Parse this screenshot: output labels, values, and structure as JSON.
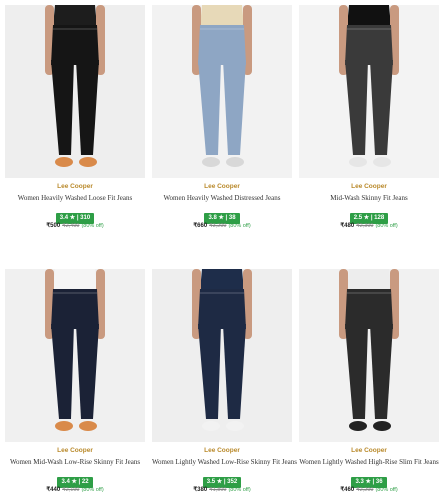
{
  "products": [
    {
      "brand": "Lee Cooper",
      "title": "Women Heavily Washed Loose Fit Jeans",
      "rating": "3.4 ★ | 310",
      "price": "₹500",
      "mrp": "₹2,499",
      "discount": "(80% off)",
      "jeans_color": "#151515",
      "bg_color": "#eeeeee",
      "top_color": "#1d1d1d",
      "shoe_color": "#d98a4a"
    },
    {
      "brand": "Lee Cooper",
      "title": "Women Heavily Washed Distressed Jeans",
      "rating": "3.8 ★ | 38",
      "price": "₹660",
      "mrp": "₹3,299",
      "discount": "(80% off)",
      "jeans_color": "#8ea6c4",
      "bg_color": "#f2f2f2",
      "top_color": "#e7d9b8",
      "shoe_color": "#d8d8d8"
    },
    {
      "brand": "Lee Cooper",
      "title": "Mid-Wash Skinny Fit Jeans",
      "rating": "2.5 ★ | 128",
      "price": "₹480",
      "mrp": "₹2,399",
      "discount": "(80% off)",
      "jeans_color": "#3a3a3a",
      "bg_color": "#f3f3f3",
      "top_color": "#111111",
      "shoe_color": "#e6e6e6"
    },
    {
      "brand": "Lee Cooper",
      "title": "Women Mid-Wash Low-Rise Skinny Fit Jeans",
      "rating": "3.4 ★ | 22",
      "price": "₹440",
      "mrp": "₹2,199",
      "discount": "(80% off)",
      "jeans_color": "#1b2236",
      "bg_color": "#f0f0f0",
      "top_color": "#f5f5f5",
      "shoe_color": "#d98a4a"
    },
    {
      "brand": "Lee Cooper",
      "title": "Women Lightly Washed Low-Rise Skinny Fit Jeans",
      "rating": "3.5 ★ | 352",
      "price": "₹380",
      "mrp": "₹1,899",
      "discount": "(80% off)",
      "jeans_color": "#1e2a44",
      "bg_color": "#eeeeee",
      "top_color": "#1e2d4a",
      "shoe_color": "#f2f2f2"
    },
    {
      "brand": "Lee Cooper",
      "title": "Women Lightly Washed High-Rise Slim Fit Jeans",
      "rating": "3.3 ★ | 36",
      "price": "₹460",
      "mrp": "₹2,299",
      "discount": "(80% off)",
      "jeans_color": "#2b2b2b",
      "bg_color": "#f1f1f1",
      "top_color": "#ededed",
      "shoe_color": "#222222"
    }
  ]
}
